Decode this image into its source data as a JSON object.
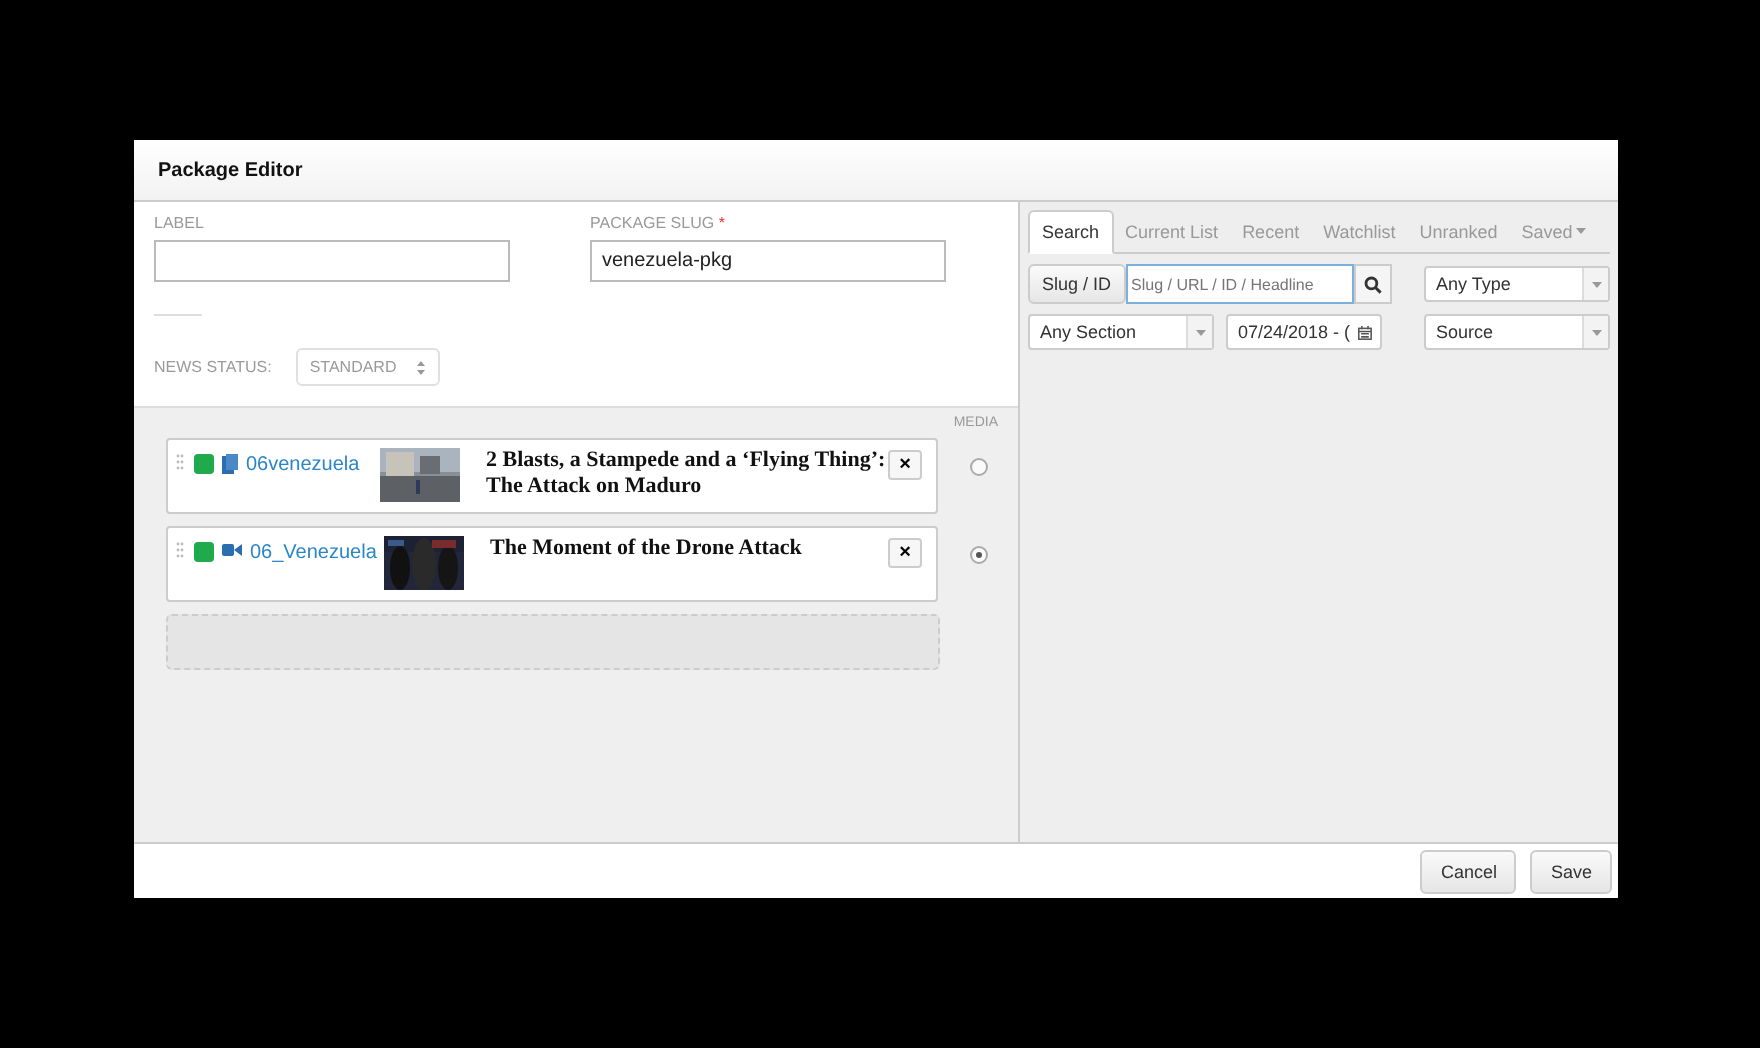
{
  "window": {
    "title": "Package Editor"
  },
  "form": {
    "label_field": {
      "label": "LABEL"
    },
    "slug_field": {
      "label": "PACKAGE SLUG",
      "required_mark": "*",
      "value": "venezuela-pkg"
    },
    "news_status": {
      "label": "NEWS STATUS:",
      "value": "STANDARD"
    }
  },
  "media_header": "MEDIA",
  "items": [
    {
      "slug": "06venezuela",
      "kind": "article",
      "headline": "2 Blasts, a Stampede and a ‘Flying Thing’: The Attack on Maduro",
      "remove": "×",
      "media_selected": false
    },
    {
      "slug": "06_Venezuela",
      "kind": "video",
      "headline": "The Moment of the Drone Attack",
      "remove": "×",
      "media_selected": true
    }
  ],
  "search_panel": {
    "tabs": [
      {
        "label": "Search",
        "selected": true
      },
      {
        "label": "Current List",
        "selected": false
      },
      {
        "label": "Recent",
        "selected": false
      },
      {
        "label": "Watchlist",
        "selected": false
      },
      {
        "label": "Unranked",
        "selected": false
      },
      {
        "label": "Saved",
        "selected": false,
        "dropdown": true
      }
    ],
    "slug_button": "Slug / ID",
    "search_placeholder": "Slug / URL / ID / Headline",
    "type_select": "Any Type",
    "section_select": "Any Section",
    "date_field": "07/24/2018 - (",
    "source_select": "Source"
  },
  "footer": {
    "buttons": [
      "Cancel",
      "Save"
    ]
  }
}
